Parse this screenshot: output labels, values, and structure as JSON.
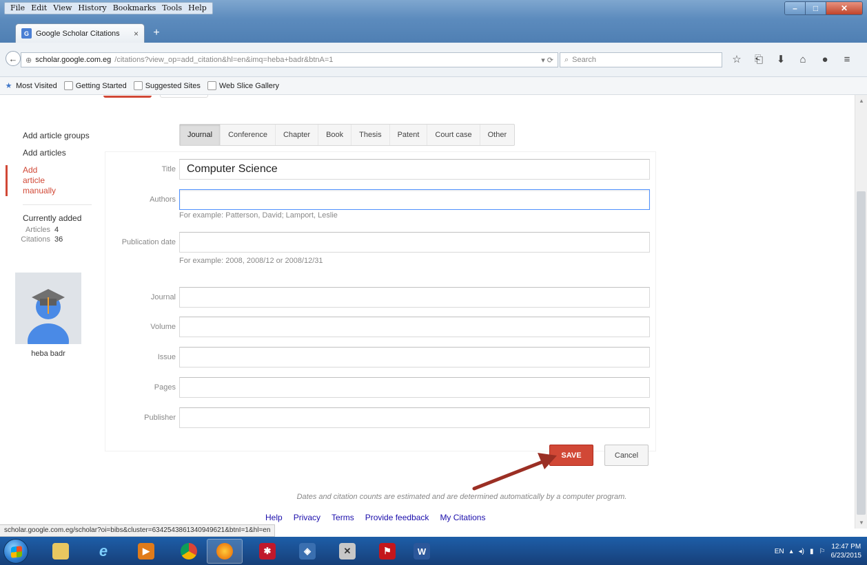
{
  "browser": {
    "menus": [
      "File",
      "Edit",
      "View",
      "History",
      "Bookmarks",
      "Tools",
      "Help"
    ],
    "tab_title": "Google Scholar Citations",
    "url_host": "scholar.google.com.eg",
    "url_path": "/citations?view_op=add_citation&hl=en&imq=heba+badr&btnA=1",
    "search_placeholder": "Search",
    "bookmarks": [
      "Most Visited",
      "Getting Started",
      "Suggested Sites",
      "Web Slice Gallery"
    ],
    "status_url": "scholar.google.com.eg/scholar?oi=bibs&cluster=6342543861340949621&btnI=1&hl=en"
  },
  "sidebar": {
    "items": [
      "Add article groups",
      "Add articles",
      "Add article manually"
    ],
    "currently_added": "Currently added",
    "articles_label": "Articles",
    "articles_value": "4",
    "citations_label": "Citations",
    "citations_value": "36",
    "user_name": "heba badr"
  },
  "type_tabs": [
    "Journal",
    "Conference",
    "Chapter",
    "Book",
    "Thesis",
    "Patent",
    "Court case",
    "Other"
  ],
  "form": {
    "title_label": "Title",
    "title_value": "Computer Science",
    "authors_label": "Authors",
    "authors_hint": "For example: Patterson, David; Lamport, Leslie",
    "pubdate_label": "Publication date",
    "pubdate_hint": "For example: 2008, 2008/12 or 2008/12/31",
    "journal_label": "Journal",
    "volume_label": "Volume",
    "issue_label": "Issue",
    "pages_label": "Pages",
    "publisher_label": "Publisher"
  },
  "buttons": {
    "save": "SAVE",
    "cancel": "Cancel"
  },
  "disclaimer": "Dates and citation counts are estimated and are determined automatically by a computer program.",
  "footer": [
    "Help",
    "Privacy",
    "Terms",
    "Provide feedback",
    "My Citations"
  ],
  "taskbar": {
    "lang": "EN",
    "time": "12:47 PM",
    "date": "6/23/2015"
  },
  "colors": {
    "accent": "#d14836",
    "link": "#1a0dab",
    "arrow": "#9b2f24",
    "focus": "#4d90fe"
  }
}
